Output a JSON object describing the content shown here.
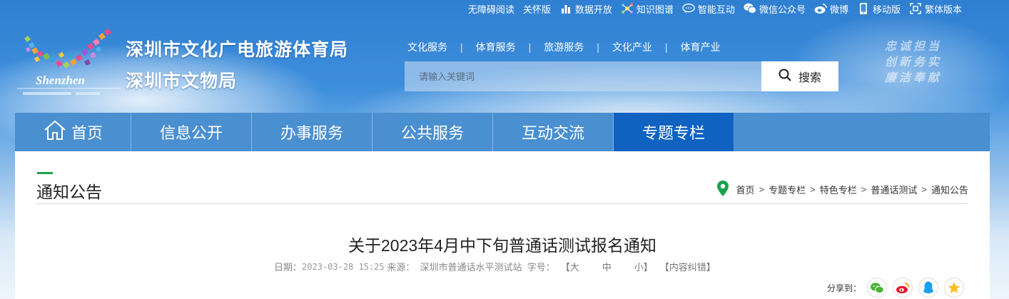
{
  "topbar": {
    "items": [
      {
        "label": "无障碍阅读",
        "icon": ""
      },
      {
        "label": "关怀版",
        "icon": ""
      },
      {
        "label": "数据开放",
        "icon": "bar-chart-icon"
      },
      {
        "label": "知识图谱",
        "icon": "knowledge-graph-icon"
      },
      {
        "label": "智能互动",
        "icon": "chat-bubble-icon"
      },
      {
        "label": "微信公众号",
        "icon": "wechat-icon"
      },
      {
        "label": "微博",
        "icon": "weibo-icon"
      },
      {
        "label": "移动版",
        "icon": "mobile-icon"
      },
      {
        "label": "繁体版本",
        "icon": "traditional-chinese-icon"
      }
    ]
  },
  "header": {
    "logo_text": "Shenzhen",
    "site_name_line1": "深圳市文化广电旅游体育局",
    "site_name_line2": "深圳市文物局",
    "slogan": [
      "忠诚担当",
      "创新务实",
      "廉洁奉献"
    ]
  },
  "quicklinks": [
    "文化服务",
    "体育服务",
    "旅游服务",
    "文化产业",
    "体育产业"
  ],
  "search": {
    "placeholder": "请输入关键词",
    "button_label": "搜索"
  },
  "nav": {
    "items": [
      "首页",
      "信息公开",
      "办事服务",
      "公共服务",
      "互动交流",
      "专题专栏"
    ],
    "active_index": 5
  },
  "section": {
    "title": "通知公告"
  },
  "breadcrumb": [
    "首页",
    "专题专栏",
    "特色专栏",
    "普通话测试",
    "通知公告"
  ],
  "article": {
    "title": "关于2023年4月中下旬普通话测试报名通知",
    "date_label": "日期：",
    "date": "2023-03-28 15:25",
    "source_label": " 来源：",
    "source": "  深圳市普通话水平测试站",
    "fontsize_label": "  字号：",
    "size_large": "【大",
    "size_medium": "中",
    "size_small": "小】",
    "correction": "【内容纠错】"
  },
  "share": {
    "label": "分享到：",
    "targets": [
      "wechat-icon",
      "weibo-icon",
      "qq-icon",
      "qzone-icon"
    ]
  },
  "colors": {
    "nav_bg": "#4a8fd0",
    "nav_active": "#0f62c0",
    "accent_green": "#1aa34a"
  }
}
